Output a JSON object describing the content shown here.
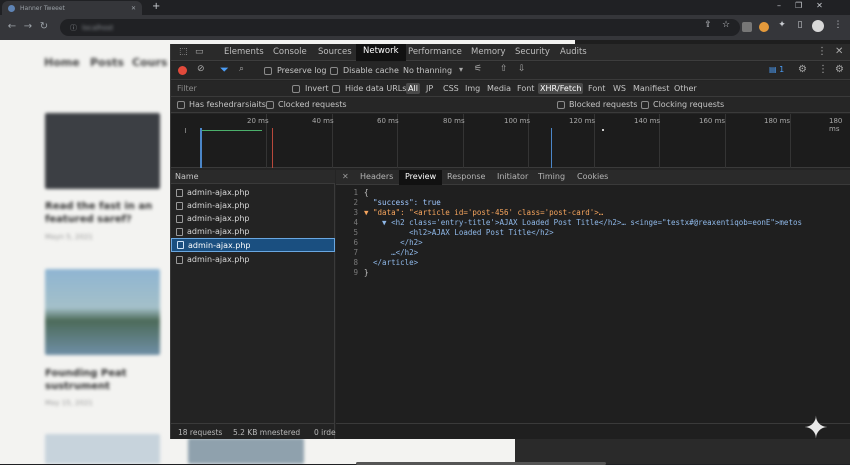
{
  "browser": {
    "tab_title": "Hanner Tweeet",
    "new_tab": "+",
    "url": "localhost",
    "window_controls": [
      "–",
      "❐",
      "✕"
    ]
  },
  "webpage": {
    "nav": [
      "Home",
      "Posts",
      "Cours"
    ],
    "posts": [
      {
        "title": "Read the fast in an featured saref?",
        "date": "Mayn 5, 2021"
      },
      {
        "title": "Founding Peat sustrument",
        "date": "May 15, 2021"
      }
    ]
  },
  "devtools": {
    "tabs": [
      "Elements",
      "Console",
      "Sources",
      "Network",
      "Performance",
      "Memory",
      "Security",
      "Audits"
    ],
    "active_tab": "Network",
    "toolbar": {
      "preserve_log": "Preserve log",
      "disable_cache": "Disable cache",
      "throttle": "No thanning",
      "badge": "1"
    },
    "filter": {
      "placeholder": "Filter",
      "invert": "Invert",
      "hide_data_urls": "Hide data URLs",
      "types": [
        "All",
        "JP",
        "CSS",
        "Img",
        "Media",
        "Font",
        "XHR/Fetch",
        "Font",
        "WS",
        "Manifiest",
        "Other"
      ],
      "selected_types": [
        "All",
        "XHR/Fetch"
      ]
    },
    "row4": {
      "has_blocked": "Has feshedrarsiaits",
      "blocked_requests": "Clocked requests",
      "blocked_requests2": "Blocked requests",
      "clocking_requests": "Clocking requests"
    },
    "timeline_ticks": [
      "20 ms",
      "40 ms",
      "60 ms",
      "80 ms",
      "100 ms",
      "120 ms",
      "140 ms",
      "160 ms",
      "180 ms",
      "180 ms"
    ],
    "name_header": "Name",
    "requests": [
      "admin-ajax.php",
      "admin-ajax.php",
      "admin-ajax.php",
      "admin-ajax.php",
      "admin-ajax.php",
      "admin-ajax.php"
    ],
    "selected_request": 4,
    "status": {
      "requests": "18 requests",
      "transferred": "5.2 KB mnestered",
      "extra": "0 irde"
    },
    "detail_tabs": [
      "Headers",
      "Preview",
      "Response",
      "Initiator",
      "Timing",
      "Cookies"
    ],
    "active_detail_tab": "Preview",
    "code_lines": [
      {
        "n": "1",
        "text": "{"
      },
      {
        "n": "2",
        "text": "  \"success\": true"
      },
      {
        "n": "3",
        "text": "▼ \"data\": \"<article id='post-456' class='post-card'>…"
      },
      {
        "n": "4",
        "text": "    ▼ <h2 class='entry-title'>AJAX Loaded Post Title</h2>… s<inge=\"testx#@reaxentiqob=eonE\">metos"
      },
      {
        "n": "5",
        "text": "          <hl2>AJAX Loaded Post Title</h2>"
      },
      {
        "n": "6",
        "text": "        </h2>"
      },
      {
        "n": "7",
        "text": "      …</h2>"
      },
      {
        "n": "8",
        "text": "  </article>"
      },
      {
        "n": "9",
        "text": "}"
      }
    ]
  }
}
